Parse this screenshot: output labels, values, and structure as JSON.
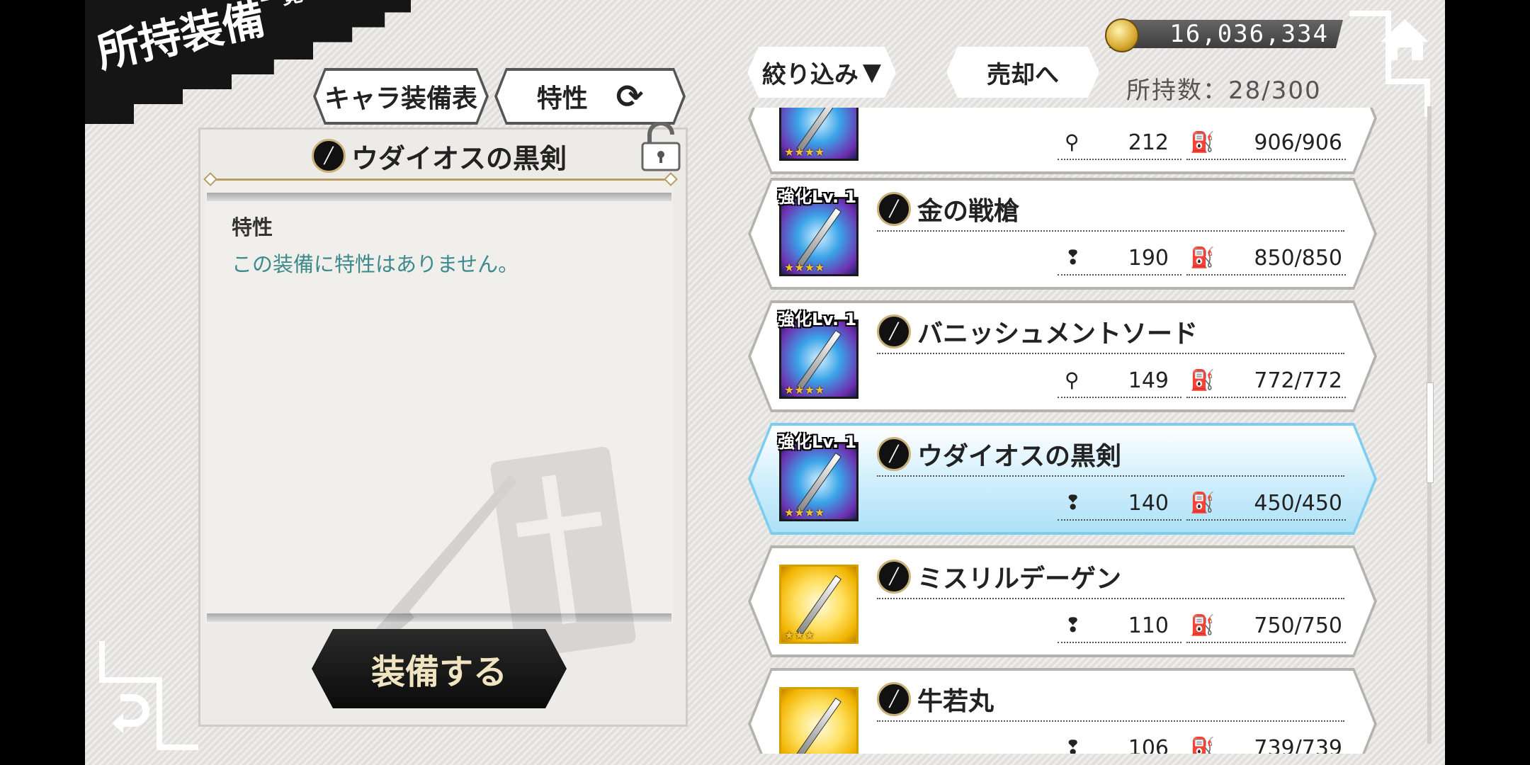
{
  "header": {
    "title_main": "所持装備",
    "title_small": "一覧"
  },
  "tabs": [
    {
      "label": "キャラ装備表"
    },
    {
      "label": "特性"
    }
  ],
  "detail": {
    "item_name": "ウダイオスの黒剣",
    "trait_label": "特性",
    "trait_text": "この装備に特性はありません。",
    "equip_button": "装備する"
  },
  "toolbar": {
    "filter_label": "絞り込み",
    "sell_label": "売却へ",
    "gold": "16,036,334",
    "count_label": "所持数：28/300"
  },
  "items": [
    {
      "name": "",
      "enh": "",
      "stat1_icon": "ring-icon",
      "stat1": "212",
      "stat2": "906/906",
      "stars": "★★★★",
      "rarity": "rainbow",
      "partial": true
    },
    {
      "name": "金の戦槍",
      "enh": "強化Lv. 1",
      "stat1_icon": "exclaim-icon",
      "stat1": "190",
      "stat2": "850/850",
      "stars": "★★★★",
      "rarity": "rainbow"
    },
    {
      "name": "バニッシュメントソード",
      "enh": "強化Lv. 1",
      "stat1_icon": "ring-icon",
      "stat1": "149",
      "stat2": "772/772",
      "stars": "★★★★",
      "rarity": "rainbow"
    },
    {
      "name": "ウダイオスの黒剣",
      "enh": "強化Lv. 1",
      "stat1_icon": "exclaim-icon",
      "stat1": "140",
      "stat2": "450/450",
      "stars": "★★★★",
      "rarity": "rainbow",
      "selected": true
    },
    {
      "name": "ミスリルデーゲン",
      "enh": "",
      "stat1_icon": "exclaim-icon",
      "stat1": "110",
      "stat2": "750/750",
      "stars": "★★★",
      "rarity": "gold"
    },
    {
      "name": "牛若丸",
      "enh": "",
      "stat1_icon": "exclaim-icon",
      "stat1": "106",
      "stat2": "739/739",
      "stars": "★★★",
      "rarity": "gold"
    }
  ]
}
